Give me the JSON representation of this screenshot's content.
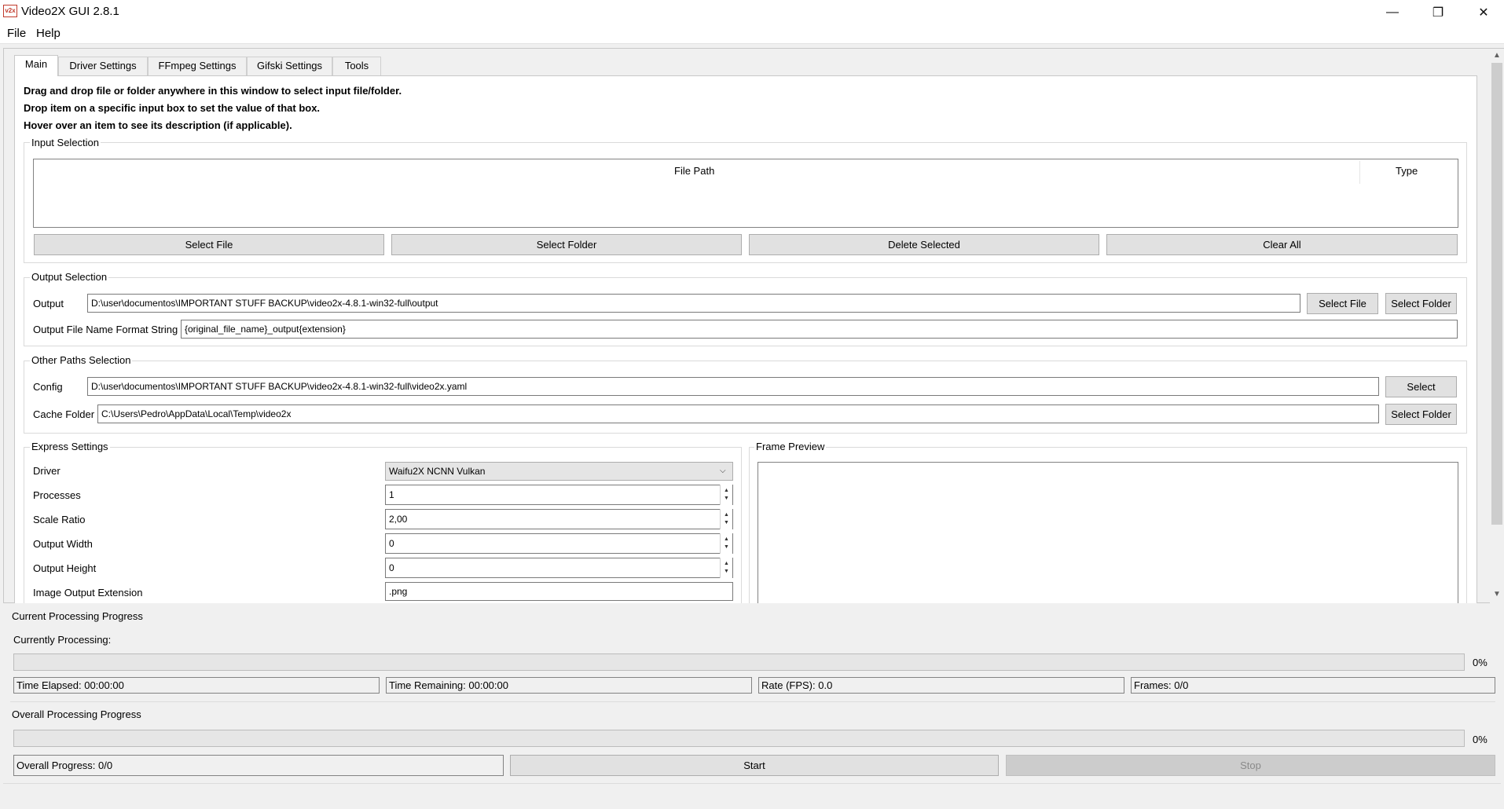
{
  "window": {
    "icon_text": "v2x",
    "title": "Video2X GUI 2.8.1",
    "minimize_glyph": "—",
    "maximize_glyph": "❐",
    "close_glyph": "✕"
  },
  "menu": {
    "file": "File",
    "help": "Help"
  },
  "tabs": {
    "main": "Main",
    "driver": "Driver Settings",
    "ffmpeg": "FFmpeg Settings",
    "gifski": "Gifski Settings",
    "tools": "Tools"
  },
  "info": {
    "line1": "Drag and drop file or folder anywhere in this window to select input file/folder.",
    "line2": "Drop item on a specific input box to set the value of that box.",
    "line3": "Hover over an item to see its description (if applicable)."
  },
  "input_selection": {
    "title": "Input Selection",
    "columns": {
      "file_path": "File Path",
      "type": "Type"
    },
    "select_file": "Select File",
    "select_folder": "Select Folder",
    "delete_selected": "Delete Selected",
    "clear_all": "Clear All"
  },
  "output_selection": {
    "title": "Output Selection",
    "output_label": "Output",
    "output_value": "D:\\user\\documentos\\IMPORTANT STUFF BACKUP\\video2x-4.8.1-win32-full\\output",
    "select_file": "Select File",
    "select_folder": "Select Folder",
    "format_label": "Output File Name Format String",
    "format_value": "{original_file_name}_output{extension}"
  },
  "other_paths": {
    "title": "Other Paths Selection",
    "config_label": "Config",
    "config_value": "D:\\user\\documentos\\IMPORTANT STUFF BACKUP\\video2x-4.8.1-win32-full\\video2x.yaml",
    "config_select": "Select",
    "cache_label": "Cache Folder",
    "cache_value": "C:\\Users\\Pedro\\AppData\\Local\\Temp\\video2x",
    "cache_select": "Select Folder"
  },
  "express": {
    "title": "Express Settings",
    "driver_label": "Driver",
    "driver_value": "Waifu2X NCNN Vulkan",
    "processes_label": "Processes",
    "processes_value": "1",
    "scale_label": "Scale Ratio",
    "scale_value": "2,00",
    "width_label": "Output Width",
    "width_value": "0",
    "height_label": "Output Height",
    "height_value": "0",
    "ext_label": "Image Output Extension",
    "ext_value": ".png"
  },
  "frame_preview": {
    "title": "Frame Preview"
  },
  "current_progress": {
    "title": "Current Processing Progress",
    "currently_processing": "Currently Processing:",
    "progress": 0,
    "percent_text": "0%",
    "time_elapsed": "Time Elapsed: 00:00:00",
    "time_remaining": "Time Remaining: 00:00:00",
    "rate": "Rate (FPS): 0.0",
    "frames": "Frames: 0/0"
  },
  "overall_progress": {
    "title": "Overall Processing Progress",
    "progress": 0,
    "percent_text": "0%",
    "overall": "Overall Progress: 0/0",
    "start": "Start",
    "stop": "Stop"
  }
}
